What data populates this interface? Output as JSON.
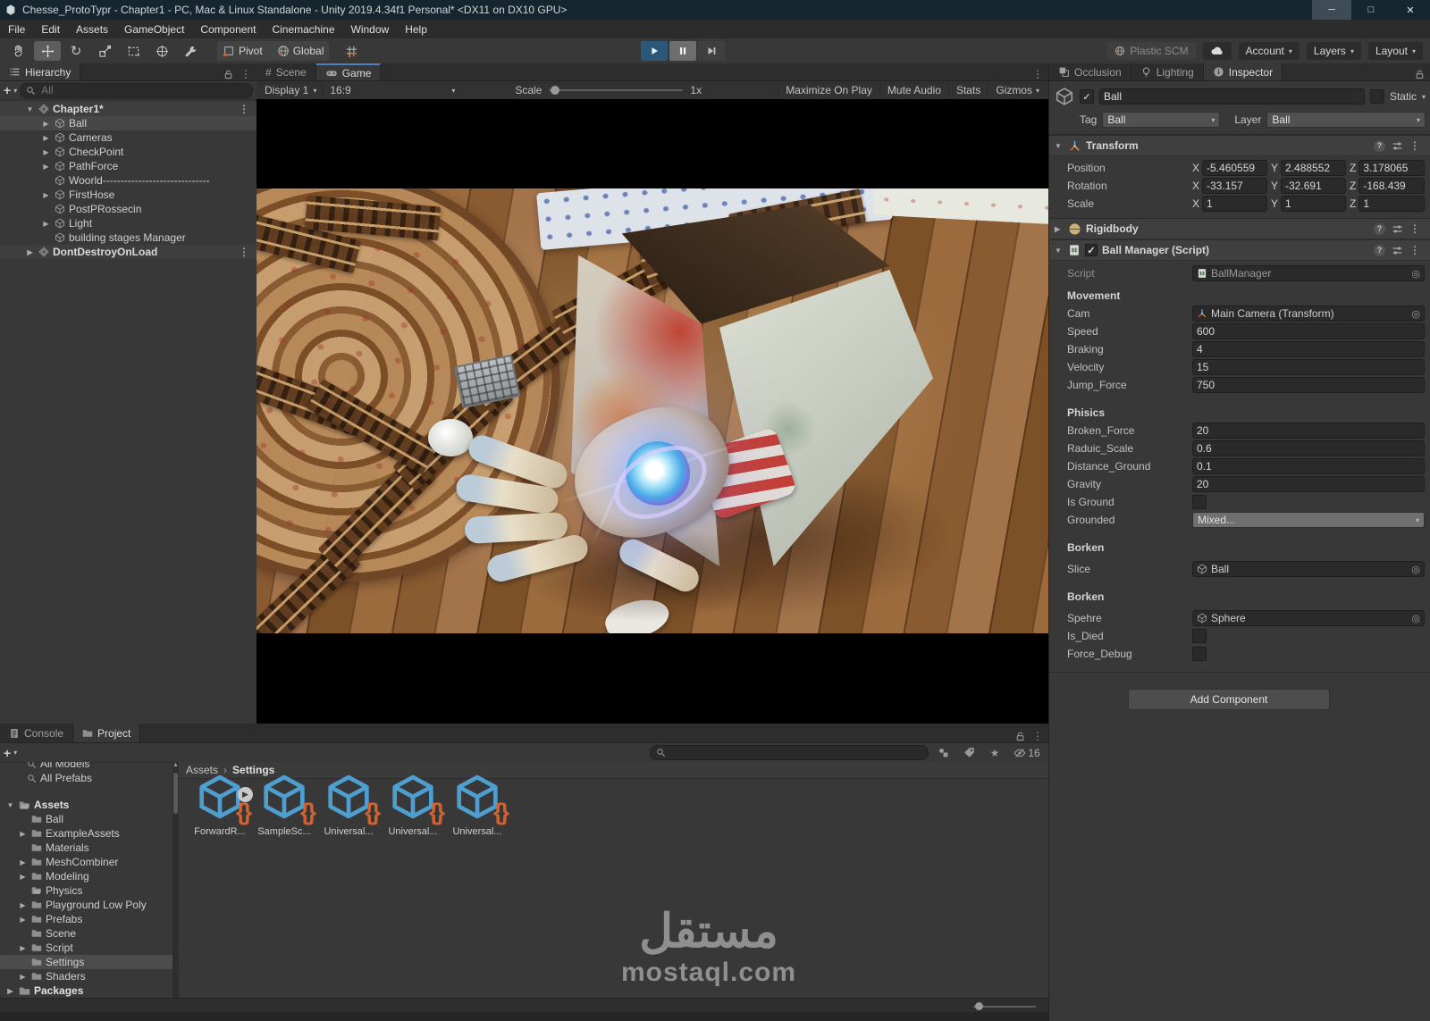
{
  "window": {
    "title": "Chesse_ProtoTypr - Chapter1 - PC, Mac & Linux Standalone - Unity 2019.4.34f1 Personal* <DX11 on DX10 GPU>"
  },
  "menus": [
    "File",
    "Edit",
    "Assets",
    "GameObject",
    "Component",
    "Cinemachine",
    "Window",
    "Help"
  ],
  "toolbar": {
    "pivot": "Pivot",
    "global": "Global",
    "plastic_scm": "Plastic SCM",
    "account": "Account",
    "layers": "Layers",
    "layout": "Layout"
  },
  "hierarchy": {
    "title": "Hierarchy",
    "search_placeholder": "All",
    "items": [
      "Chapter1*",
      "Ball",
      "Cameras",
      "CheckPoint",
      "PathForce",
      "Woorld------------------------------",
      "FirstHose",
      "PostPRossecin",
      "Light",
      "building stages Manager",
      "DontDestroyOnLoad"
    ]
  },
  "game": {
    "tabs": [
      "Scene",
      "Game"
    ],
    "display": "Display 1",
    "aspect": "16:9",
    "scale_label": "Scale",
    "scale_value": "1x",
    "buttons": [
      "Maximize On Play",
      "Mute Audio",
      "Stats",
      "Gizmos"
    ]
  },
  "inspector": {
    "tabs": [
      "Occlusion",
      "Lighting",
      "Inspector"
    ],
    "header": {
      "name": "Ball",
      "static_label": "Static",
      "tag_label": "Tag",
      "tag_value": "Ball",
      "layer_label": "Layer",
      "layer_value": "Ball"
    },
    "transform": {
      "title": "Transform",
      "axis": [
        "X",
        "Y",
        "Z"
      ],
      "rows": [
        {
          "label": "Position",
          "x": "-5.460559",
          "y": "2.488552",
          "z": "3.178065"
        },
        {
          "label": "Rotation",
          "x": "-33.157",
          "y": "-32.691",
          "z": "-168.439"
        },
        {
          "label": "Scale",
          "x": "1",
          "y": "1",
          "z": "1"
        }
      ]
    },
    "rigidbody_title": "Rigidbody",
    "ball_manager": {
      "title": "Ball Manager (Script)",
      "script_label": "Script",
      "script_value": "BallManager",
      "movement": {
        "header": "Movement",
        "cam_label": "Cam",
        "cam_value": "Main Camera (Transform)",
        "fields": [
          {
            "label": "Speed",
            "value": "600"
          },
          {
            "label": "Braking",
            "value": "4"
          },
          {
            "label": "Velocity",
            "value": "15"
          },
          {
            "label": "Jump_Force",
            "value": "750"
          }
        ]
      },
      "phisics": {
        "header": "Phisics",
        "fields": [
          {
            "label": "Broken_Force",
            "value": "20"
          },
          {
            "label": "Raduic_Scale",
            "value": "0.6"
          },
          {
            "label": "Distance_Ground",
            "value": "0.1"
          },
          {
            "label": "Gravity",
            "value": "20"
          }
        ],
        "is_ground_label": "Is Ground",
        "grounded_label": "Grounded",
        "grounded_value": "Mixed..."
      },
      "borken1": {
        "header": "Borken",
        "slice_label": "Slice",
        "slice_value": "Ball"
      },
      "borken2": {
        "header": "Borken",
        "spehre_label": "Spehre",
        "spehre_value": "Sphere",
        "is_died_label": "Is_Died",
        "force_debug_label": "Force_Debug"
      }
    },
    "add_component": "Add Component"
  },
  "project": {
    "tabs": [
      "Console",
      "Project"
    ],
    "breadcrumb": [
      "Assets",
      "Settings"
    ],
    "hidden_count": "16",
    "tree": [
      "All Models",
      "All Prefabs",
      "Assets",
      "Ball",
      "ExampleAssets",
      "Materials",
      "MeshCombiner",
      "Modeling",
      "Physics",
      "Playground Low Poly",
      "Prefabs",
      "Scene",
      "Script",
      "Settings",
      "Shaders",
      "Packages"
    ],
    "assets": [
      "ForwardR...",
      "SampleSc...",
      "Universal...",
      "Universal...",
      "Universal..."
    ]
  },
  "watermark": {
    "arabic": "مستقل",
    "domain": "mostaql.com"
  },
  "icons": {
    "kebab": "vertical-ellipsis",
    "caret_down": "dropdown-caret",
    "accent_orange": "#d2622f",
    "asset_blue": "#4e9fd0",
    "play_active_bg": "#2b5878",
    "focus_blue": "#4f7fbe"
  }
}
